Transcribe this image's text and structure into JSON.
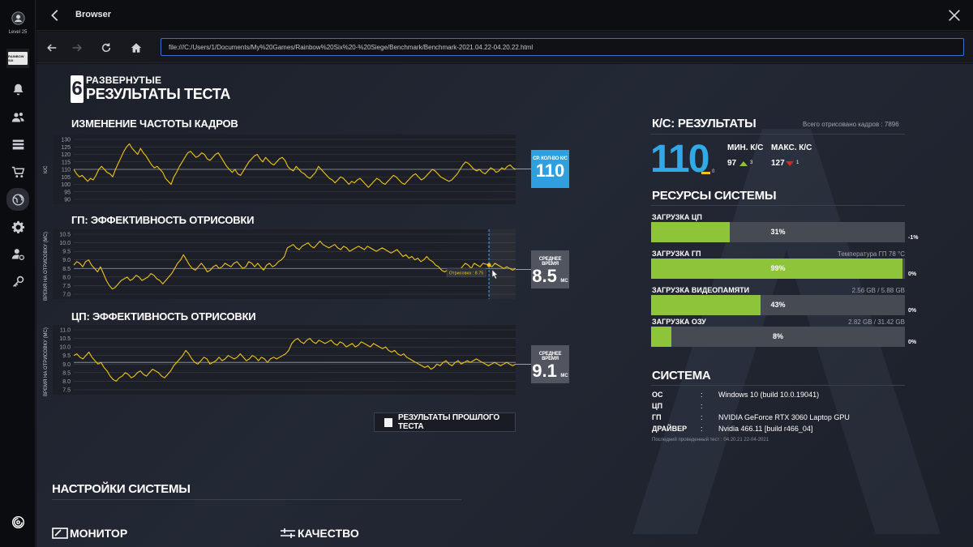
{
  "sidebar": {
    "level_label": "Level 25",
    "game_thumb_text": "RAINBOW SIX"
  },
  "topbar": {
    "title": "Browser"
  },
  "nav": {
    "address": "file:///C:/Users/1/Documents/My%20Games/Rainbow%20Six%20-%20Siege/Benchmark/Benchmark-2021.04.22-04.20.22.html"
  },
  "page": {
    "logo_glyph": "6",
    "heading_line1": "РАЗВЕРНУТЫЕ",
    "heading_line2": "РЕЗУЛЬТАТЫ ТЕСТА"
  },
  "charts": {
    "fps": {
      "title": "ИЗМЕНЕНИЕ ЧАСТОТЫ КАДРОВ",
      "y_title": "К/С",
      "metric_label": "СР. КОЛ-ВО К/С",
      "metric_value": "110"
    },
    "gpu": {
      "title": "ГП: ЭФФЕКТИВНОСТЬ ОТРИСОВКИ",
      "y_title": "ВРЕМЯ НА ОТРИСОВКУ (МС)",
      "metric_label": "СРЕДНЕЕ ВРЕМЯ",
      "metric_value": "8.5",
      "metric_unit": "МС",
      "tooltip": "Отрисовка : 8.75"
    },
    "cpu": {
      "title": "ЦП: ЭФФЕКТИВНОСТЬ ОТРИСОВКИ",
      "y_title": "ВРЕМЯ НА ОТРИСОВКУ (МС)",
      "metric_label": "СРЕДНЕЕ ВРЕМЯ",
      "metric_value": "9.1",
      "metric_unit": "МС"
    }
  },
  "chart_data": [
    {
      "type": "line",
      "title": "ИЗМЕНЕНИЕ ЧАСТОТЫ КАДРОВ",
      "ylabel": "К/С",
      "ylim": [
        90,
        130
      ],
      "yticks": [
        90,
        95,
        100,
        105,
        110,
        115,
        120,
        125,
        130
      ],
      "reference_line": 110,
      "grid": true,
      "series": [
        {
          "values": [
            110,
            107,
            105,
            106,
            104,
            102,
            104,
            103,
            106,
            110,
            112,
            110,
            108,
            107,
            105,
            110,
            114,
            118,
            122,
            125,
            127,
            124,
            122,
            120,
            124,
            121,
            119,
            116,
            113,
            111,
            112,
            110,
            108,
            104,
            102,
            100,
            105,
            108,
            112,
            115,
            118,
            121,
            122,
            120,
            118,
            119,
            121,
            120,
            117,
            116,
            118,
            120,
            121,
            118,
            115,
            112,
            110,
            108,
            110,
            107,
            106,
            109,
            112,
            115,
            117,
            119,
            120,
            117,
            115,
            118,
            116,
            114,
            113,
            115,
            117,
            118,
            116,
            112,
            110,
            109,
            112,
            110,
            108,
            107,
            105,
            104,
            106,
            108,
            112,
            110,
            108,
            106,
            104,
            103,
            101,
            103,
            105,
            104,
            102,
            100,
            102,
            101,
            103,
            104,
            102,
            100,
            98,
            100,
            102,
            104,
            103,
            101,
            100,
            102,
            104,
            106,
            105,
            103,
            101,
            100,
            102,
            104,
            106,
            107,
            105,
            103,
            104,
            106,
            108,
            110,
            109,
            107,
            105,
            104,
            103,
            102,
            103,
            105,
            107,
            110,
            113,
            115,
            114,
            112,
            110,
            109,
            110,
            108,
            107,
            109,
            111,
            110,
            108,
            109,
            111,
            110,
            112,
            113,
            111,
            110
          ]
        }
      ]
    },
    {
      "type": "line",
      "title": "ГП: ЭФФЕКТИВНОСТЬ ОТРИСОВКИ",
      "ylabel": "ВРЕМЯ НА ОТРИСОВКУ (МС)",
      "ylim": [
        7.0,
        10.5
      ],
      "yticks": [
        7.0,
        7.5,
        8.0,
        8.5,
        9.0,
        9.5,
        10.0,
        10.5
      ],
      "reference_line": 8.5,
      "grid": true,
      "series": [
        {
          "values": [
            8.7,
            8.9,
            8.8,
            8.6,
            8.9,
            9.0,
            8.7,
            8.5,
            8.3,
            8.6,
            8.2,
            7.8,
            7.5,
            7.3,
            7.4,
            7.6,
            7.8,
            7.9,
            8.0,
            7.8,
            7.9,
            8.1,
            8.0,
            7.8,
            7.9,
            8.0,
            8.2,
            8.1,
            7.9,
            7.8,
            7.6,
            7.8,
            8.0,
            8.2,
            8.5,
            8.8,
            9.0,
            9.3,
            9.0,
            8.7,
            8.5,
            8.4,
            8.6,
            8.8,
            8.6,
            8.3,
            8.4,
            8.6,
            8.7,
            8.5,
            8.6,
            8.8,
            8.7,
            8.6,
            8.8,
            8.9,
            8.7,
            8.5,
            8.6,
            8.9,
            8.8,
            8.6,
            8.8,
            8.6,
            8.4,
            8.7,
            8.8,
            8.6,
            8.7,
            8.9,
            9.0,
            9.2,
            9.7,
            9.8,
            9.9,
            9.7,
            9.6,
            9.8,
            9.9,
            10.0,
            9.8,
            9.7,
            9.9,
            10.1,
            9.9,
            9.8,
            9.7,
            9.8,
            9.9,
            9.7,
            9.6,
            9.8,
            9.7,
            9.5,
            9.6,
            9.7,
            9.8,
            9.7,
            9.6,
            9.8,
            9.7,
            9.6,
            9.5,
            9.6,
            9.7,
            9.6,
            9.5,
            9.4,
            9.5,
            9.6,
            9.4,
            9.2,
            9.3,
            9.1,
            9.2,
            9.0,
            9.1,
            8.9,
            9.0,
            9.2,
            9.0,
            8.9,
            8.7,
            8.6,
            8.4,
            8.3,
            8.4,
            8.2,
            8.3,
            8.5,
            8.4,
            8.6,
            8.8,
            8.7,
            8.5,
            8.8,
            8.7,
            8.6,
            8.8,
            8.75,
            8.7,
            8.6,
            8.8,
            8.7,
            8.6,
            8.5,
            8.6,
            8.5,
            8.4,
            8.5
          ]
        }
      ]
    },
    {
      "type": "line",
      "title": "ЦП: ЭФФЕКТИВНОСТЬ ОТРИСОВКИ",
      "ylabel": "ВРЕМЯ НА ОТРИСОВКУ (МС)",
      "ylim": [
        7.5,
        11.0
      ],
      "yticks": [
        7.5,
        8.0,
        8.5,
        9.0,
        9.5,
        10.0,
        10.5,
        11.0
      ],
      "reference_line": 9.1,
      "grid": true,
      "series": [
        {
          "values": [
            9.5,
            9.6,
            9.4,
            9.3,
            9.5,
            9.7,
            9.4,
            9.2,
            9.0,
            9.1,
            8.8,
            8.6,
            8.3,
            8.1,
            8.0,
            8.2,
            8.3,
            8.5,
            8.4,
            8.2,
            8.3,
            8.5,
            8.6,
            8.4,
            8.3,
            8.5,
            8.7,
            8.6,
            8.5,
            8.3,
            8.2,
            8.4,
            8.6,
            8.9,
            9.1,
            9.3,
            9.5,
            9.8,
            9.6,
            9.3,
            9.1,
            9.0,
            9.2,
            9.4,
            9.3,
            9.0,
            9.1,
            9.2,
            9.4,
            9.2,
            9.3,
            9.5,
            9.4,
            9.3,
            9.4,
            9.6,
            9.4,
            9.2,
            9.3,
            9.5,
            9.4,
            9.2,
            9.4,
            9.3,
            9.1,
            9.3,
            9.4,
            9.3,
            9.4,
            9.5,
            9.6,
            9.8,
            10.2,
            10.4,
            10.5,
            10.3,
            10.2,
            10.4,
            10.5,
            10.3,
            10.2,
            10.4,
            10.3,
            10.2,
            10.3,
            10.4,
            10.2,
            10.1,
            10.3,
            10.2,
            10.0,
            10.1,
            10.2,
            10.0,
            10.1,
            10.3,
            10.2,
            10.1,
            10.0,
            10.2,
            10.1,
            10.0,
            9.9,
            10.0,
            9.8,
            9.7,
            9.8,
            9.6,
            9.5,
            9.6,
            9.4,
            9.3,
            9.2,
            9.1,
            9.0,
            8.9,
            8.8,
            8.9,
            8.7,
            8.8,
            9.0,
            8.9,
            9.1,
            9.2,
            9.0,
            8.9,
            9.1,
            9.2,
            9.0,
            9.1,
            9.2,
            9.1,
            9.2,
            9.3,
            9.2,
            9.1,
            9.0,
            8.9,
            9.0,
            9.1,
            9.0,
            8.9,
            9.0,
            9.1,
            9.0,
            8.9,
            9.0
          ]
        }
      ]
    }
  ],
  "prev_results": {
    "label": "РЕЗУЛЬТАТЫ ПРОШЛОГО ТЕСТА"
  },
  "settings": {
    "title": "НАСТРОЙКИ СИСТЕМЫ",
    "tab_monitor": "МОНИТОР",
    "tab_quality": "КАЧЕСТВО"
  },
  "fps_results": {
    "title": "К/С: РЕЗУЛЬТАТЫ",
    "frames_total": "Всего отрисовано кадров : 7896",
    "average": "110",
    "average_small": "0",
    "min_label": "МИН. К/С",
    "min_value": "97",
    "min_count": "3",
    "max_label": "МАКС. К/С",
    "max_value": "127",
    "max_count": "1"
  },
  "resources": {
    "title": "РЕСУРСЫ СИСТЕМЫ",
    "items": [
      {
        "label": "ЗАГРУЗКА ЦП",
        "extra": "",
        "percent": 31,
        "percent_text": "31%",
        "side": "-1%"
      },
      {
        "label": "ЗАГРУЗКА ГП",
        "extra": "Температура ГП 78 °C",
        "percent": 99,
        "percent_text": "99%",
        "side": "0%"
      },
      {
        "label": "ЗАГРУЗКА ВИДЕОПАМЯТИ",
        "extra": "2.56 GB / 5.88 GB",
        "percent": 43,
        "percent_text": "43%",
        "side": "0%"
      },
      {
        "label": "ЗАГРУЗКА ОЗУ",
        "extra": "2.82 GB / 31.42 GB",
        "percent": 8,
        "percent_text": "8%",
        "side": "0%"
      }
    ]
  },
  "system": {
    "title": "СИСТЕМА",
    "rows": [
      {
        "key": "ОС",
        "value": "Windows 10 (build 10.0.19041)"
      },
      {
        "key": "ЦП",
        "value": ""
      },
      {
        "key": "ГП",
        "value": "NVIDIA GeForce RTX 3060 Laptop GPU"
      },
      {
        "key": "ДРАЙВЕР",
        "value": "Nvidia 466.11 [build r466_04]"
      }
    ],
    "last_test": "Последний проведенный тест : 04.20.21 22-04-2021"
  },
  "colors": {
    "accent_blue": "#2fa9e8",
    "metric_blue": "#2fa0df",
    "line_yellow": "#f2c417",
    "bar_green": "#8dc43a",
    "arrow_red": "#e02525",
    "address_border": "#3a6fd8"
  }
}
